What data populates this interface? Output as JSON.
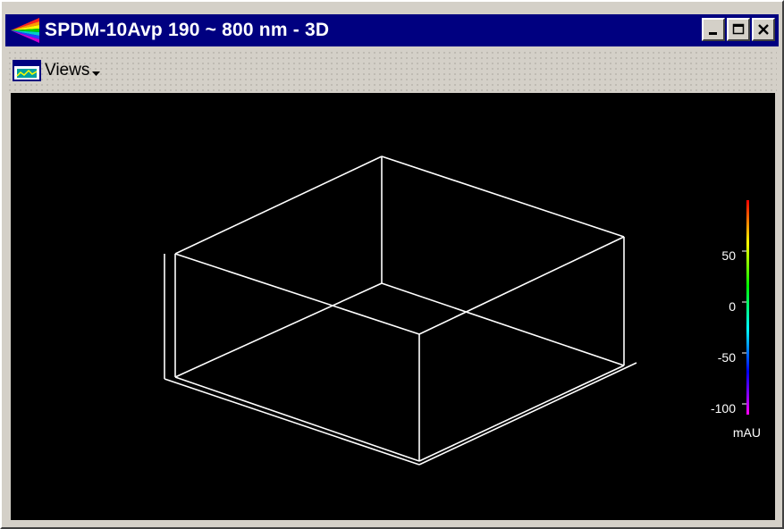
{
  "window": {
    "title": "SPDM-10Avp 190 ~ 800 nm - 3D",
    "controls": [
      "minimize",
      "maximize",
      "close"
    ]
  },
  "toolbar": {
    "views_label": "Views",
    "views_icon": "views-panel-icon"
  },
  "plot": {
    "type": "3d-wireframe-box",
    "background": "#000000",
    "frame_color": "#ffffff",
    "colorbar": {
      "unit": "mAU",
      "ticks": [
        {
          "label": "50",
          "value": 50
        },
        {
          "label": "0",
          "value": 0
        },
        {
          "label": "-50",
          "value": -50
        },
        {
          "label": "-100",
          "value": -100
        }
      ],
      "colors": [
        "#ff0000",
        "#ffff00",
        "#00ff00",
        "#00ffff",
        "#0000ff",
        "#ff00ff"
      ]
    }
  }
}
